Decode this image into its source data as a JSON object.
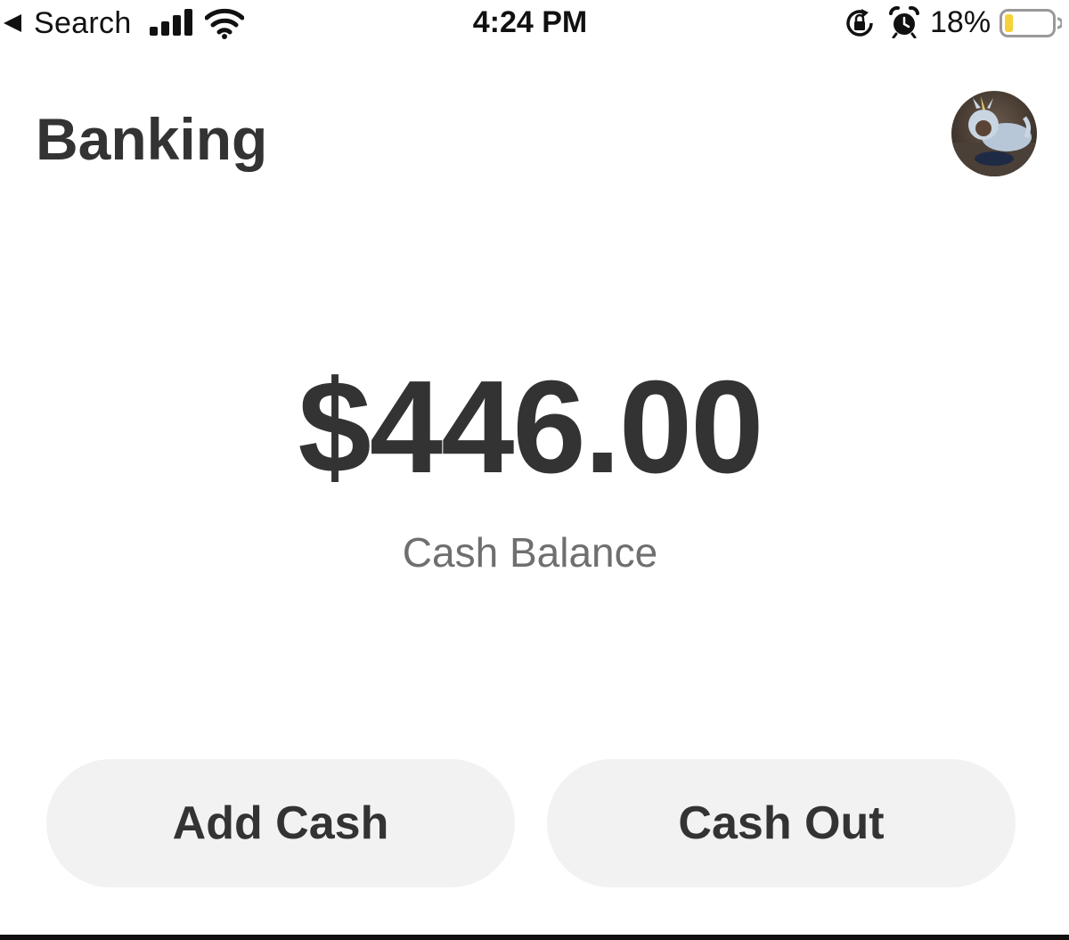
{
  "status_bar": {
    "back_label": "Search",
    "time": "4:24 PM",
    "battery_percent": "18%",
    "battery_level": 0.18,
    "battery_color": "#f5d23a",
    "icons": [
      "back-arrow-icon",
      "cellular-signal-icon",
      "wifi-icon",
      "rotation-lock-icon",
      "alarm-icon",
      "battery-icon"
    ]
  },
  "header": {
    "title": "Banking",
    "avatar_icon": "profile-avatar"
  },
  "balance": {
    "amount": "$446.00",
    "label": "Cash Balance"
  },
  "actions": {
    "add_cash_label": "Add Cash",
    "cash_out_label": "Cash Out"
  },
  "colors": {
    "text_primary": "#333333",
    "text_secondary": "#6f6f6f",
    "button_background": "#f2f2f2",
    "background": "#ffffff"
  }
}
